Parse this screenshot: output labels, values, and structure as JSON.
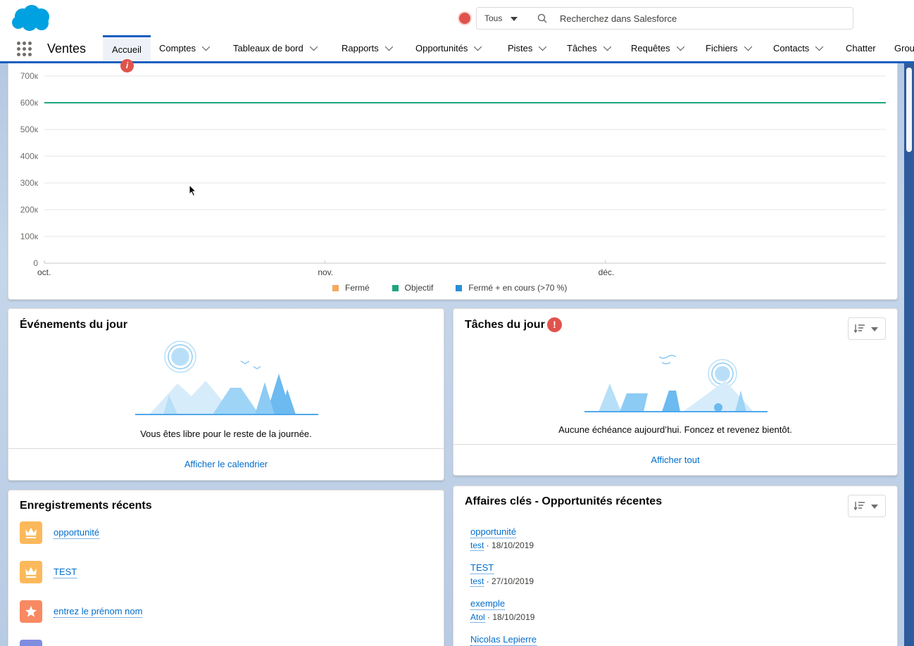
{
  "header": {
    "search_scope": "Tous",
    "search_placeholder": "Recherchez dans Salesforce"
  },
  "nav": {
    "app_name": "Ventes",
    "tabs": [
      {
        "label": "Accueil",
        "active": true,
        "dropdown": false
      },
      {
        "label": "Comptes",
        "dropdown": true
      },
      {
        "label": "Tableaux de bord",
        "dropdown": true
      },
      {
        "label": "Rapports",
        "dropdown": true
      },
      {
        "label": "Opportunités",
        "dropdown": true
      },
      {
        "label": "Pistes",
        "dropdown": true
      },
      {
        "label": "Tâches",
        "dropdown": true
      },
      {
        "label": "Requêtes",
        "dropdown": true
      },
      {
        "label": "Fichiers",
        "dropdown": true
      },
      {
        "label": "Contacts",
        "dropdown": true
      },
      {
        "label": "Chatter",
        "dropdown": false
      },
      {
        "label": "Grou",
        "dropdown": false
      }
    ],
    "home_badge": "i"
  },
  "chart_data": {
    "type": "line",
    "ytick_labels": [
      "0",
      "100к",
      "200к",
      "300к",
      "400к",
      "500к",
      "600к",
      "700к"
    ],
    "ylim": [
      0,
      700000
    ],
    "xtick_labels": [
      "oct.",
      "nov.",
      "déc."
    ],
    "series": [
      {
        "name": "Fermé",
        "color": "#f4a95c",
        "values": []
      },
      {
        "name": "Objectif",
        "color": "#1fa57e",
        "values": [
          600000,
          600000
        ]
      },
      {
        "name": "Fermé + en cours (>70 %)",
        "color": "#2a8fd4",
        "values": []
      }
    ],
    "grid": true,
    "legend_position": "bottom"
  },
  "events": {
    "title": "Événements du jour",
    "message": "Vous êtes libre pour le reste de la journée.",
    "footer_link": "Afficher le calendrier"
  },
  "tasks": {
    "title": "Tâches du jour",
    "alert": "!",
    "message": "Aucune échéance aujourd’hui. Foncez et revenez bientôt.",
    "footer_link": "Afficher tout"
  },
  "recent": {
    "title": "Enregistrements récents",
    "items": [
      {
        "label": "opportunité",
        "icon": "crown-icon",
        "color": "#fcb95b"
      },
      {
        "label": "TEST",
        "icon": "crown-icon",
        "color": "#fcb95b"
      },
      {
        "label": "entrez le prénom nom",
        "icon": "lead-star-icon",
        "color": "#f88962"
      },
      {
        "label": "",
        "icon": "record-icon",
        "color": "#7f8de1"
      }
    ]
  },
  "deals": {
    "title": "Affaires clés - Opportunités récentes",
    "items": [
      {
        "name": "opportunité",
        "account": "test",
        "date": "18/10/2019"
      },
      {
        "name": "TEST",
        "account": "test",
        "date": "27/10/2019"
      },
      {
        "name": "exemple",
        "account": "Atol",
        "date": "18/10/2019"
      },
      {
        "name": "Nicolas Lepierre",
        "account": "",
        "date": ""
      }
    ]
  }
}
